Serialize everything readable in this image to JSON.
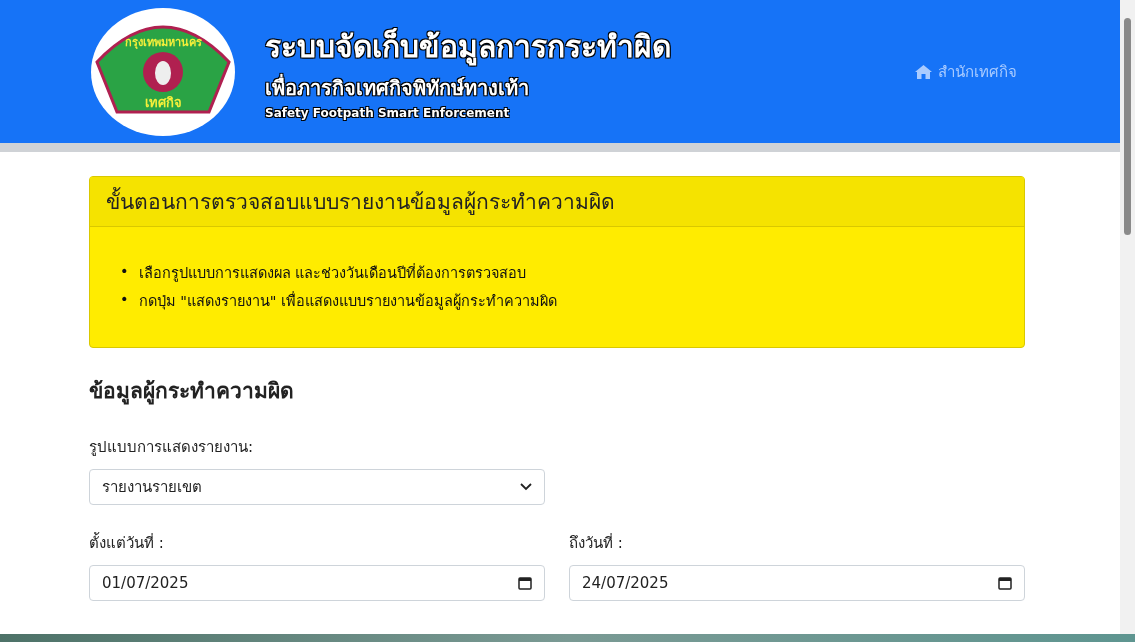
{
  "header": {
    "logo": {
      "top_text": "กรุงเทพมหานคร",
      "bottom_text": "เทศกิจ"
    },
    "title": "ระบบจัดเก็บข้อมูลการกระทำผิด",
    "subtitle": "เพื่อภารกิจเทศกิจพิทักษ์ทางเท้า",
    "tagline": "Safety Footpath Smart Enforcement",
    "nav_link": "สำนักเทศกิจ"
  },
  "alert": {
    "title": "ขั้นตอนการตรวจสอบแบบรายงานข้อมูลผู้กระทำความผิด",
    "items": [
      {
        "marker": "•",
        "text": "เลือกรูปแบบการแสดงผล และช่วงวันเดือนปีที่ต้องการตรวจสอบ"
      },
      {
        "marker": "•",
        "text": "กดปุ่ม \"แสดงรายงาน\" เพื่อแสดงแบบรายงานข้อมูลผู้กระทำความผิด"
      }
    ]
  },
  "form": {
    "heading": "ข้อมูลผู้กระทำความผิด",
    "report_type": {
      "label": "รูปแบบการแสดงรายงาน:",
      "value": "รายงานรายเขต"
    },
    "date_from": {
      "label": "ตั้งแต่วันที่ :",
      "value": "01/07/2025"
    },
    "date_to": {
      "label": "ถึงวันที่ :",
      "value": "24/07/2025"
    }
  }
}
